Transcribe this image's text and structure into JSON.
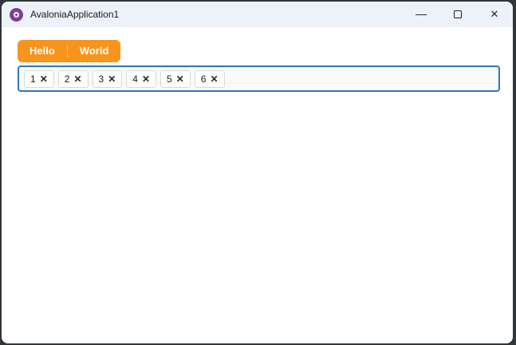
{
  "window": {
    "title": "AvaloniaApplication1"
  },
  "icons": {
    "logo": "avalonia-logo",
    "minimize": "—",
    "close": "✕",
    "chip_remove": "✕"
  },
  "tabs": [
    {
      "label": "Hello"
    },
    {
      "label": "World"
    }
  ],
  "tag_box": {
    "items": [
      {
        "label": "1"
      },
      {
        "label": "2"
      },
      {
        "label": "3"
      },
      {
        "label": "4"
      },
      {
        "label": "5"
      },
      {
        "label": "6"
      }
    ]
  },
  "colors": {
    "accent_orange": "#F7941E",
    "focus_border": "#3176B5",
    "titlebar_bg": "#EDF2F8",
    "frame_dark": "#323639"
  }
}
